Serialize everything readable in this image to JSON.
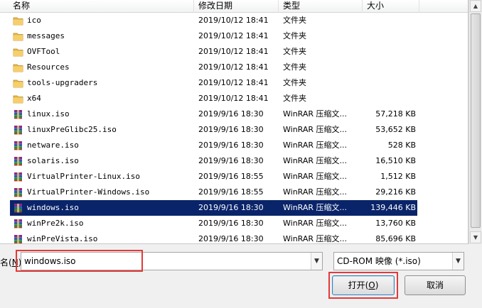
{
  "columns": {
    "name": "名称",
    "date": "修改日期",
    "type": "类型",
    "size": "大小"
  },
  "files": [
    {
      "name": "ico",
      "date": "2019/10/12 18:41",
      "type": "文件夹",
      "size": "",
      "icon": "folder-icon"
    },
    {
      "name": "messages",
      "date": "2019/10/12 18:41",
      "type": "文件夹",
      "size": "",
      "icon": "folder-icon"
    },
    {
      "name": "OVFTool",
      "date": "2019/10/12 18:41",
      "type": "文件夹",
      "size": "",
      "icon": "folder-icon"
    },
    {
      "name": "Resources",
      "date": "2019/10/12 18:41",
      "type": "文件夹",
      "size": "",
      "icon": "folder-icon"
    },
    {
      "name": "tools-upgraders",
      "date": "2019/10/12 18:41",
      "type": "文件夹",
      "size": "",
      "icon": "folder-icon"
    },
    {
      "name": "x64",
      "date": "2019/10/12 18:41",
      "type": "文件夹",
      "size": "",
      "icon": "folder-icon"
    },
    {
      "name": "linux.iso",
      "date": "2019/9/16 18:30",
      "type": "WinRAR 压缩文...",
      "size": "57,218 KB",
      "icon": "winrar-archive-icon"
    },
    {
      "name": "linuxPreGlibc25.iso",
      "date": "2019/9/16 18:30",
      "type": "WinRAR 压缩文...",
      "size": "53,652 KB",
      "icon": "winrar-archive-icon"
    },
    {
      "name": "netware.iso",
      "date": "2019/9/16 18:30",
      "type": "WinRAR 压缩文...",
      "size": "528 KB",
      "icon": "winrar-archive-icon"
    },
    {
      "name": "solaris.iso",
      "date": "2019/9/16 18:30",
      "type": "WinRAR 压缩文...",
      "size": "16,510 KB",
      "icon": "winrar-archive-icon"
    },
    {
      "name": "VirtualPrinter-Linux.iso",
      "date": "2019/9/16 18:55",
      "type": "WinRAR 压缩文...",
      "size": "1,512 KB",
      "icon": "winrar-archive-icon"
    },
    {
      "name": "VirtualPrinter-Windows.iso",
      "date": "2019/9/16 18:55",
      "type": "WinRAR 压缩文...",
      "size": "29,216 KB",
      "icon": "winrar-archive-icon"
    },
    {
      "name": "windows.iso",
      "date": "2019/9/16 18:30",
      "type": "WinRAR 压缩文...",
      "size": "139,446 KB",
      "icon": "winrar-archive-icon",
      "selected": true
    },
    {
      "name": "winPre2k.iso",
      "date": "2019/9/16 18:30",
      "type": "WinRAR 压缩文...",
      "size": "13,760 KB",
      "icon": "winrar-archive-icon"
    },
    {
      "name": "winPreVista.iso",
      "date": "2019/9/16 18:30",
      "type": "WinRAR 压缩文...",
      "size": "85,696 KB",
      "icon": "winrar-archive-icon"
    }
  ],
  "filename": {
    "label_prefix": "名(",
    "label_key": "N",
    "label_suffix": "):",
    "value": "windows.iso"
  },
  "filetype": {
    "selected": "CD-ROM 映像 (*.iso)"
  },
  "buttons": {
    "open_prefix": "打开(",
    "open_key": "O",
    "open_suffix": ")",
    "cancel": "取消"
  },
  "colors": {
    "selection": "#0a246a",
    "highlight_box": "#e23a3a",
    "folder": "#e8b84a"
  }
}
